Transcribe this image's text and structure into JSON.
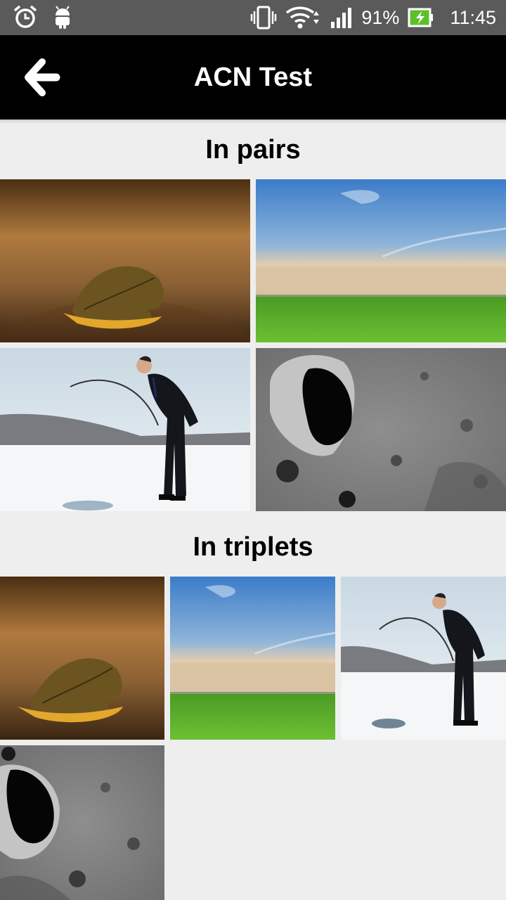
{
  "status_bar": {
    "battery": "91%",
    "time": "11:45",
    "icons": [
      "alarm-icon",
      "android-icon",
      "vibrate-icon",
      "wifi-icon",
      "signal-icon",
      "battery-icon"
    ]
  },
  "app_bar": {
    "title": "ACN Test",
    "back_icon": "arrow-left-icon"
  },
  "sections": [
    {
      "title": "In pairs",
      "images": [
        "leaf-photo",
        "green-field-photo",
        "ice-fishing-photo",
        "moon-crater-photo"
      ]
    },
    {
      "title": "In triplets",
      "images": [
        "leaf-photo",
        "green-field-photo",
        "ice-fishing-photo",
        "moon-crater-photo"
      ]
    }
  ],
  "colors": {
    "app_bar": "#000000",
    "status_bar": "#5a5a5a",
    "background": "#eeeeee",
    "battery_fill": "#5cc02a"
  }
}
